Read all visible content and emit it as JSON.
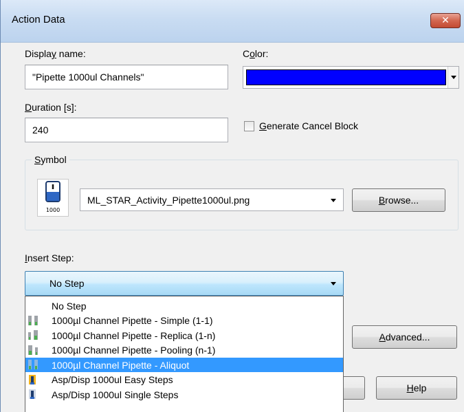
{
  "window": {
    "title": "Action Data",
    "close_label": "✕"
  },
  "display_name": {
    "label_before": "Displa",
    "label_key": "y",
    "label_after": " name:",
    "value": "\"Pipette 1000ul Channels\""
  },
  "color": {
    "label_before": "C",
    "label_key": "o",
    "label_after": "lor:",
    "value_hex": "#0000ff"
  },
  "duration": {
    "label_key": "D",
    "label_after": "uration [s]:",
    "value": "240"
  },
  "cancel_block": {
    "label_key": "G",
    "label_after": "enerate Cancel Block",
    "checked": false
  },
  "symbol": {
    "group_label_key": "S",
    "group_label_after": "ymbol",
    "icon_caption": "1000",
    "file": "ML_STAR_Activity_Pipette1000ul.png",
    "browse_key": "B",
    "browse_after": "rowse..."
  },
  "insert_step": {
    "label_key": "I",
    "label_after": "nsert Step:",
    "selected": "No Step",
    "options": [
      {
        "label": "No Step",
        "icon": "none",
        "selected": false
      },
      {
        "label": "1000µl Channel Pipette - Simple (1-1)",
        "icon": "pipette-simple-icon",
        "selected": false
      },
      {
        "label": "1000µl Channel Pipette - Replica (1-n)",
        "icon": "pipette-replica-icon",
        "selected": false
      },
      {
        "label": "1000µl Channel Pipette - Pooling (n-1)",
        "icon": "pipette-pooling-icon",
        "selected": false
      },
      {
        "label": "1000µl Channel Pipette - Aliquot",
        "icon": "pipette-aliquot-icon",
        "selected": true
      },
      {
        "label": "Asp/Disp 1000ul Easy Steps",
        "icon": "easy-steps-icon",
        "selected": false
      },
      {
        "label": "Asp/Disp 1000ul Single Steps",
        "icon": "single-steps-icon",
        "selected": false
      }
    ]
  },
  "advanced_button": {
    "key": "A",
    "after": "dvanced..."
  },
  "help_button": {
    "key": "H",
    "after": "elp"
  },
  "colors": {
    "dialog_bg": "#f0f0f0",
    "selection": "#3399ff",
    "close_red": "#c9503a",
    "color_swatch": "#0000ff"
  }
}
